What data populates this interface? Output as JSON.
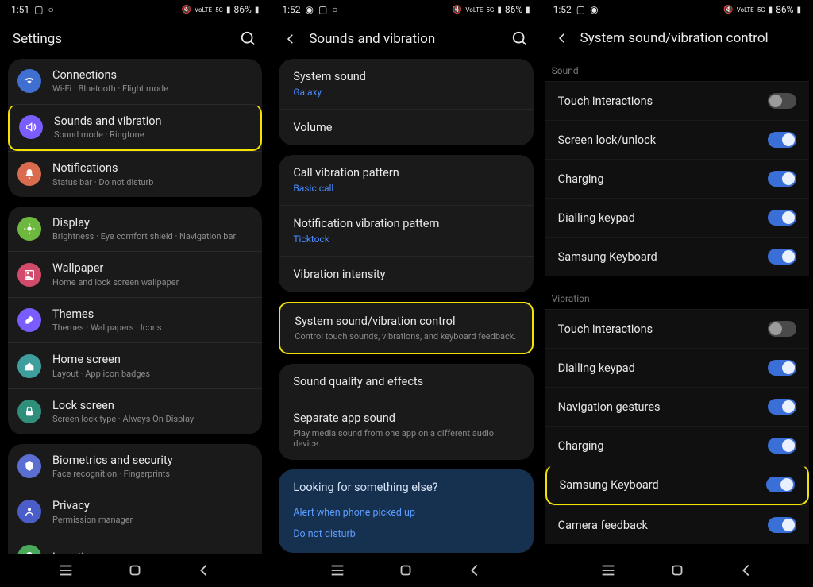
{
  "status": {
    "times": [
      "1:51",
      "1:52",
      "1:52"
    ],
    "battery": "86%",
    "status_icons_hint": "mute, VoLTE, 5G, signal"
  },
  "phone1": {
    "header_title": "Settings",
    "groups": [
      [
        {
          "icon": "wifi",
          "color": "#3f6fd1",
          "title": "Connections",
          "sub": "Wi-Fi · Bluetooth · Flight mode"
        },
        {
          "icon": "sound",
          "color": "#7a5cff",
          "title": "Sounds and vibration",
          "sub": "Sound mode · Ringtone",
          "highlight": true
        },
        {
          "icon": "bell",
          "color": "#d96b4e",
          "title": "Notifications",
          "sub": "Status bar · Do not disturb"
        }
      ],
      [
        {
          "icon": "sun",
          "color": "#6fb83f",
          "title": "Display",
          "sub": "Brightness · Eye comfort shield · Navigation bar"
        },
        {
          "icon": "wallpaper",
          "color": "#d24b6a",
          "title": "Wallpaper",
          "sub": "Home and lock screen wallpaper"
        },
        {
          "icon": "brush",
          "color": "#7a5cff",
          "title": "Themes",
          "sub": "Themes · Wallpapers · Icons"
        },
        {
          "icon": "home",
          "color": "#3f9f9f",
          "title": "Home screen",
          "sub": "Layout · App icon badges"
        },
        {
          "icon": "lock",
          "color": "#2f8f7a",
          "title": "Lock screen",
          "sub": "Screen lock type · Always On Display"
        }
      ],
      [
        {
          "icon": "shield",
          "color": "#5a6fd1",
          "title": "Biometrics and security",
          "sub": "Face recognition · Fingerprints"
        },
        {
          "icon": "privacy",
          "color": "#4a5dc8",
          "title": "Privacy",
          "sub": "Permission manager"
        },
        {
          "icon": "pin",
          "color": "#4aa85a",
          "title": "Location",
          "sub": ""
        }
      ]
    ]
  },
  "phone2": {
    "header_title": "Sounds and vibration",
    "cards": [
      [
        {
          "title": "System sound",
          "blue": "Galaxy"
        },
        {
          "title": "Volume"
        }
      ],
      [
        {
          "title": "Call vibration pattern",
          "blue": "Basic call"
        },
        {
          "title": "Notification vibration pattern",
          "blue": "Ticktock"
        },
        {
          "title": "Vibration intensity"
        }
      ],
      [
        {
          "title": "System sound/vibration control",
          "sub": "Control touch sounds, vibrations, and keyboard feedback.",
          "highlight": true
        }
      ],
      [
        {
          "title": "Sound quality and effects"
        },
        {
          "title": "Separate app sound",
          "sub": "Play media sound from one app on a different audio device."
        }
      ]
    ],
    "looking": {
      "title": "Looking for something else?",
      "links": [
        "Alert when phone picked up",
        "Do not disturb"
      ]
    }
  },
  "phone3": {
    "header_title": "System sound/vibration control",
    "sections": [
      {
        "label": "Sound",
        "items": [
          {
            "label": "Touch interactions",
            "on": false
          },
          {
            "label": "Screen lock/unlock",
            "on": true
          },
          {
            "label": "Charging",
            "on": true
          },
          {
            "label": "Dialling keypad",
            "on": true
          },
          {
            "label": "Samsung Keyboard",
            "on": true
          }
        ]
      },
      {
        "label": "Vibration",
        "items": [
          {
            "label": "Touch interactions",
            "on": false
          },
          {
            "label": "Dialling keypad",
            "on": true
          },
          {
            "label": "Navigation gestures",
            "on": true
          },
          {
            "label": "Charging",
            "on": true
          },
          {
            "label": "Samsung Keyboard",
            "on": true,
            "highlight": true
          },
          {
            "label": "Camera feedback",
            "on": true
          }
        ]
      }
    ]
  }
}
